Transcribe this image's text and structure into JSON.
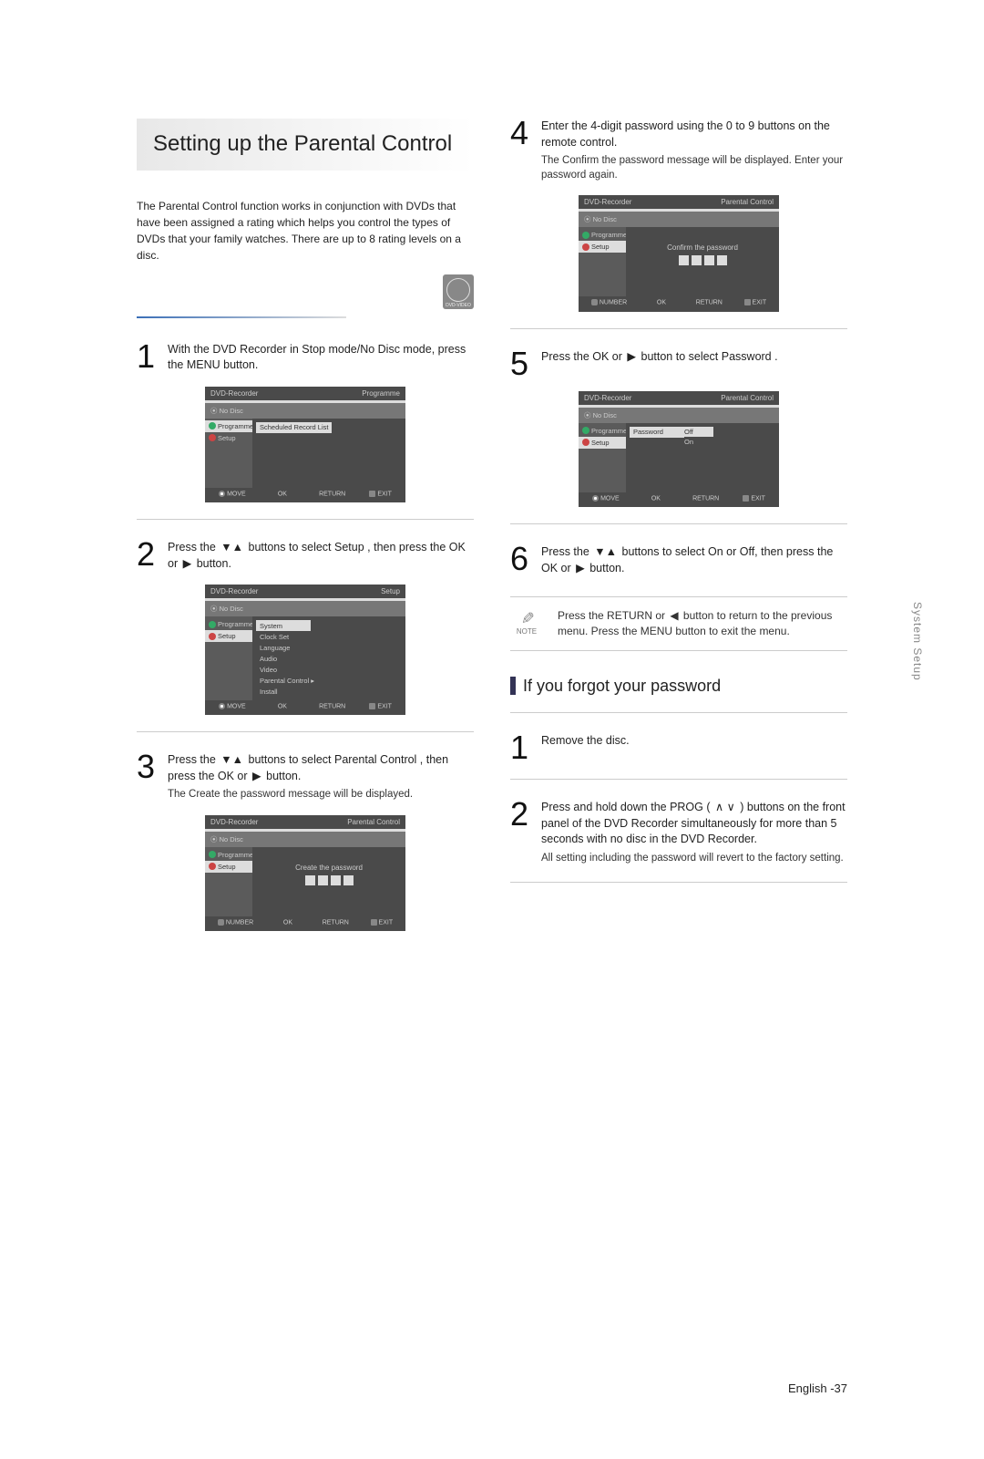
{
  "title": "Setting up the Parental Control",
  "intro": "The Parental Control function works in conjunction with DVDs that have been assigned a rating which helps you control the types of DVDs that your family watches. There are up to 8 rating levels on a disc.",
  "badge": "DVD-VIDEO",
  "steps_left": [
    {
      "num": "1",
      "text": "With the DVD Recorder in Stop mode/No Disc mode, press the MENU button.",
      "screen": {
        "title_left": "DVD-Recorder",
        "title_right": "Programme",
        "status": "No Disc",
        "left_items": [
          {
            "label": "Programme",
            "sel": true,
            "icon": "play"
          },
          {
            "label": "Setup",
            "sel": false,
            "icon": "gear"
          }
        ],
        "right_items": [
          {
            "label": "Scheduled Record List",
            "hl": true
          }
        ],
        "foot": [
          "MOVE",
          "OK",
          "RETURN",
          "EXIT"
        ],
        "foot_type": "move"
      }
    },
    {
      "num": "2",
      "text_parts": [
        "Press the ",
        "▼▲",
        " buttons to select Setup , then press the OK or ",
        "▶",
        " button."
      ],
      "screen": {
        "title_left": "DVD-Recorder",
        "title_right": "Setup",
        "status": "No Disc",
        "left_items": [
          {
            "label": "Programme",
            "sel": false,
            "icon": "play"
          },
          {
            "label": "Setup",
            "sel": true,
            "icon": "gear"
          }
        ],
        "right_items": [
          {
            "label": "System",
            "hl": true
          },
          {
            "label": "Clock Set"
          },
          {
            "label": "Language"
          },
          {
            "label": "Audio"
          },
          {
            "label": "Video"
          },
          {
            "label": "Parental Control  ▸"
          },
          {
            "label": "Install"
          }
        ],
        "foot": [
          "MOVE",
          "OK",
          "RETURN",
          "EXIT"
        ],
        "foot_type": "move"
      }
    },
    {
      "num": "3",
      "text_parts": [
        "Press the ",
        "▼▲",
        " buttons to select Parental Control , then press the OK or ",
        "▶",
        " button."
      ],
      "sub": "The  Create the password  message will be displayed.",
      "screen": {
        "title_left": "DVD-Recorder",
        "title_right": "Parental Control",
        "status": "No Disc",
        "left_items": [
          {
            "label": "Programme",
            "sel": false,
            "icon": "play"
          },
          {
            "label": "Setup",
            "sel": true,
            "icon": "gear"
          }
        ],
        "centered_text": "Create the password",
        "pw_boxes": true,
        "foot": [
          "NUMBER",
          "OK",
          "RETURN",
          "EXIT"
        ],
        "foot_type": "num"
      }
    }
  ],
  "steps_right": [
    {
      "num": "4",
      "text": "Enter the 4-digit password using the 0 to 9 buttons on the remote control.",
      "sub": "The  Confirm the password  message will be displayed. Enter your password again.",
      "screen": {
        "title_left": "DVD-Recorder",
        "title_right": "Parental Control",
        "status": "No Disc",
        "left_items": [
          {
            "label": "Programme",
            "sel": false,
            "icon": "play"
          },
          {
            "label": "Setup",
            "sel": true,
            "icon": "gear"
          }
        ],
        "centered_text": "Confirm the password",
        "pw_boxes": true,
        "foot": [
          "NUMBER",
          "OK",
          "RETURN",
          "EXIT"
        ],
        "foot_type": "num"
      }
    },
    {
      "num": "5",
      "text_parts": [
        "Press the OK or ",
        "▶",
        " button to select Password ."
      ],
      "screen": {
        "title_left": "DVD-Recorder",
        "title_right": "Parental Control",
        "status": "No Disc",
        "left_items": [
          {
            "label": "Programme",
            "sel": false,
            "icon": "play"
          },
          {
            "label": "Setup",
            "sel": true,
            "icon": "gear"
          }
        ],
        "right_items": [
          {
            "label": "Password",
            "hl": true
          }
        ],
        "dropdown": [
          {
            "label": "Off",
            "hl": true
          },
          {
            "label": "On",
            "hl": false
          }
        ],
        "foot": [
          "MOVE",
          "OK",
          "RETURN",
          "EXIT"
        ],
        "foot_type": "move"
      }
    },
    {
      "num": "6",
      "text_parts": [
        "Press the ",
        "▼▲",
        " buttons to select On or Off, then press the OK or ",
        "▶",
        " button."
      ]
    }
  ],
  "note_label": "NOTE",
  "note_text_parts": [
    "Press the RETURN or ",
    "◀",
    " button to return to the previous menu. Press the MENU button to exit the menu."
  ],
  "sub_heading": "If you forgot your password",
  "forgot_steps": [
    {
      "num": "1",
      "text": "Remove the disc."
    },
    {
      "num": "2",
      "text_parts": [
        "Press and hold down the PROG ( ",
        "∧ ∨",
        " ) buttons on the front panel of the DVD Recorder simultaneously for more than 5 seconds with no disc in the DVD Recorder."
      ],
      "sub": "All setting including the password will revert to the factory setting."
    }
  ],
  "side_label": "System Setup",
  "footer": "English -37"
}
